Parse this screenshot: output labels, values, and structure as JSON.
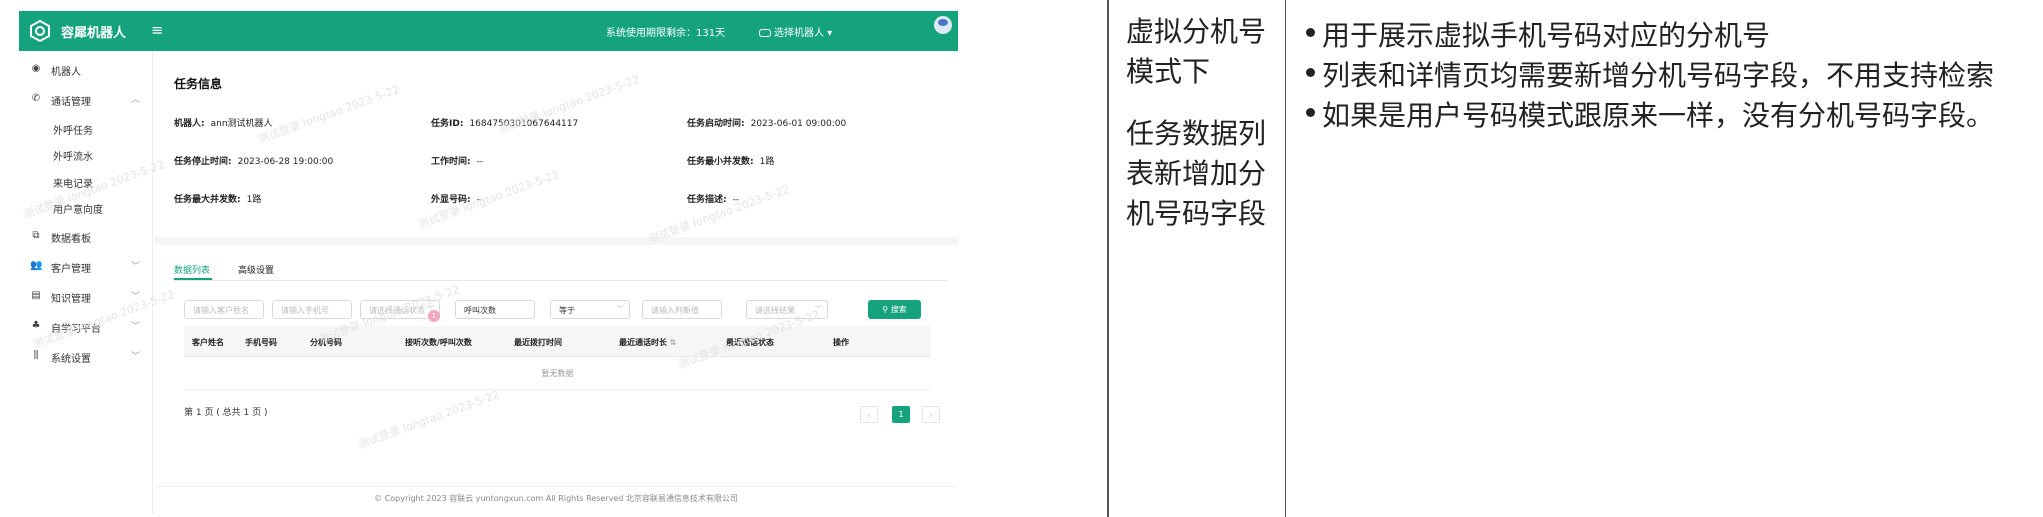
{
  "app": {
    "brand": "容犀机器人",
    "validity": "系统使用期限剩余：131天",
    "robot_select": "选择机器人"
  },
  "sidebar": {
    "items": [
      {
        "label": "机器人",
        "icon": "robot-icon"
      },
      {
        "label": "通话管理",
        "icon": "phone-icon",
        "expanded": true
      },
      {
        "label": "外呼任务",
        "sub": true
      },
      {
        "label": "外呼流水",
        "sub": true
      },
      {
        "label": "来电记录",
        "sub": true
      },
      {
        "label": "用户意向度",
        "sub": true
      },
      {
        "label": "数据看板",
        "icon": "chart-icon"
      },
      {
        "label": "客户管理",
        "icon": "users-icon"
      },
      {
        "label": "知识管理",
        "icon": "book-icon"
      },
      {
        "label": "自学习平台",
        "icon": "learn-icon"
      },
      {
        "label": "系统设置",
        "icon": "settings-icon"
      }
    ]
  },
  "task": {
    "title": "任务信息",
    "robot_label": "机器人:",
    "robot_value": "ann测试机器人",
    "task_id_label": "任务ID:",
    "task_id_value": "1684750301067644117",
    "start_label": "任务启动时间:",
    "start_value": "2023-06-01 09:00:00",
    "stop_label": "任务停止时间:",
    "stop_value": "2023-06-28 19:00:00",
    "worktime_label": "工作时间:",
    "worktime_value": "--",
    "min_label": "任务最小并发数:",
    "min_value": "1路",
    "max_label": "任务最大并发数:",
    "max_value": "1路",
    "caller_label": "外显号码:",
    "caller_value": "--",
    "desc_label": "任务描述:",
    "desc_value": "--"
  },
  "tabs": {
    "data_list": "数据列表",
    "advanced": "高级设置"
  },
  "filters": {
    "customer": "请输入客户姓名",
    "phone": "请输入手机号",
    "status": "请选择通话状态",
    "calls": "呼叫次数",
    "op": "等于",
    "judge": "请输入判断值",
    "result": "请选择结果",
    "search": "搜索"
  },
  "table": {
    "headers": [
      "客户姓名",
      "手机号码",
      "分机号码",
      "接听次数/呼叫次数",
      "最近拨打时间",
      "最近通话时长",
      "最近通话状态",
      "操作"
    ],
    "empty": "暂无数据",
    "badge": "1"
  },
  "pager": {
    "info": "第 1 页 ( 总共 1 页 )",
    "prev": "‹",
    "current": "1",
    "next": "›"
  },
  "footer": {
    "copyright": "© Copyright 2023    容联云    yuntongxun.com    All Rights Reserved  北京容联易通信息技术有限公司"
  },
  "watermark": "测试登录  longtao  2023-5-22",
  "notes": {
    "heading1": "虚拟分机号模式下",
    "heading2": "任务数据列表新增加分机号码字段",
    "bullets": [
      "用于展示虚拟手机号码对应的分机号",
      "列表和详情页均需要新增分机号码字段，不用支持检索",
      "如果是用户号码模式跟原来一样，没有分机号码字段。"
    ]
  },
  "colors": {
    "accent": "#15a37d"
  }
}
